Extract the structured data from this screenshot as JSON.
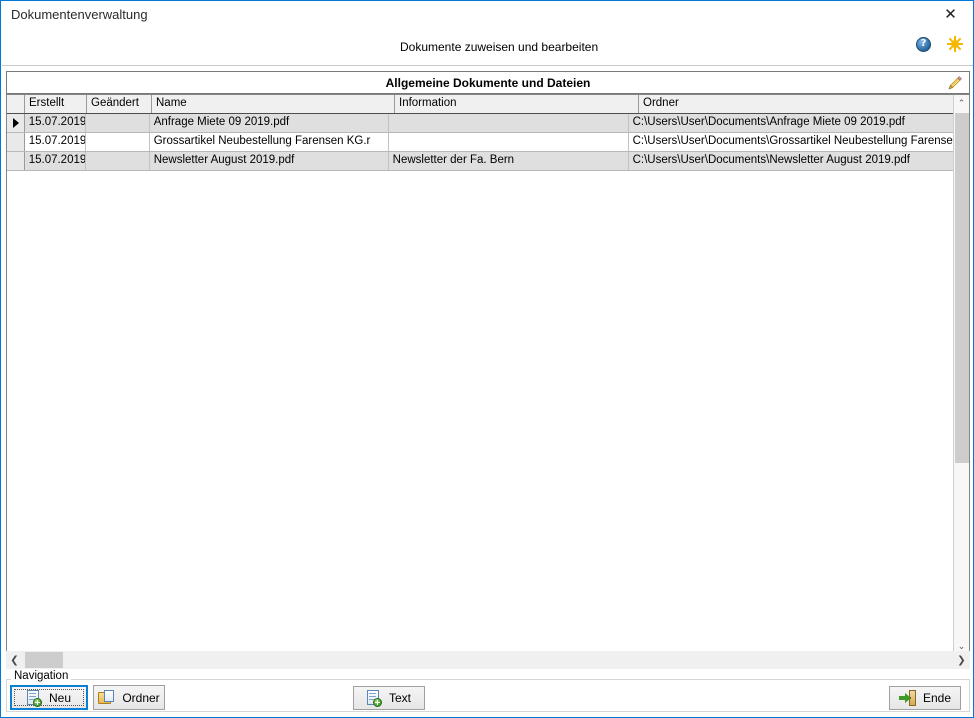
{
  "window": {
    "title": "Dokumentenverwaltung",
    "close_label": "✕",
    "close_icon": "close-icon"
  },
  "header": {
    "subtitle": "Dokumente zuweisen und bearbeiten",
    "help_icon": "help-icon",
    "settings_icon": "sun-icon"
  },
  "banner": {
    "title": "Allgemeine Dokumente und Dateien",
    "edit_icon": "pencil-icon"
  },
  "grid": {
    "columns": [
      {
        "key": "selector",
        "label": ""
      },
      {
        "key": "erstellt",
        "label": "Erstellt"
      },
      {
        "key": "geaendert",
        "label": "Geändert"
      },
      {
        "key": "name",
        "label": "Name"
      },
      {
        "key": "information",
        "label": "Information"
      },
      {
        "key": "ordner",
        "label": "Ordner"
      }
    ],
    "rows": [
      {
        "selected": true,
        "erstellt": "15.07.2019",
        "geaendert": "",
        "name": "Anfrage Miete 09 2019.pdf",
        "information": "",
        "ordner": "C:\\Users\\User\\Documents\\Anfrage Miete 09 2019.pdf"
      },
      {
        "selected": false,
        "erstellt": "15.07.2019",
        "geaendert": "",
        "name": "Grossartikel Neubestellung Farensen KG.r",
        "information": "",
        "ordner": "C:\\Users\\User\\Documents\\Grossartikel Neubestellung Farensen K"
      },
      {
        "selected": false,
        "erstellt": "15.07.2019",
        "geaendert": "",
        "name": "Newsletter August 2019.pdf",
        "information": "Newsletter der Fa. Bern",
        "ordner": "C:\\Users\\User\\Documents\\Newsletter August 2019.pdf"
      }
    ],
    "vscroll": {
      "up_glyph": "⌃",
      "down_glyph": "⌄",
      "up_icon": "chevron-up-icon",
      "down_icon": "chevron-down-icon"
    },
    "hscroll": {
      "left_glyph": "❮",
      "right_glyph": "❯",
      "left_icon": "chevron-left-icon",
      "right_icon": "chevron-right-icon"
    }
  },
  "navigation": {
    "legend": "Navigation",
    "buttons": {
      "neu": {
        "label": "Neu",
        "icon": "new-document-icon"
      },
      "ordner": {
        "label": "Ordner",
        "icon": "folder-icon"
      },
      "text": {
        "label": "Text",
        "icon": "new-document-icon"
      },
      "ende": {
        "label": "Ende",
        "icon": "exit-door-icon"
      }
    }
  },
  "colors": {
    "window_border": "#0078d7",
    "focus_border": "#0a7fd4",
    "row_alt": "#dfdfdf",
    "header_bg": "#f0f0f0",
    "scroll_thumb": "#cdcdcd"
  }
}
